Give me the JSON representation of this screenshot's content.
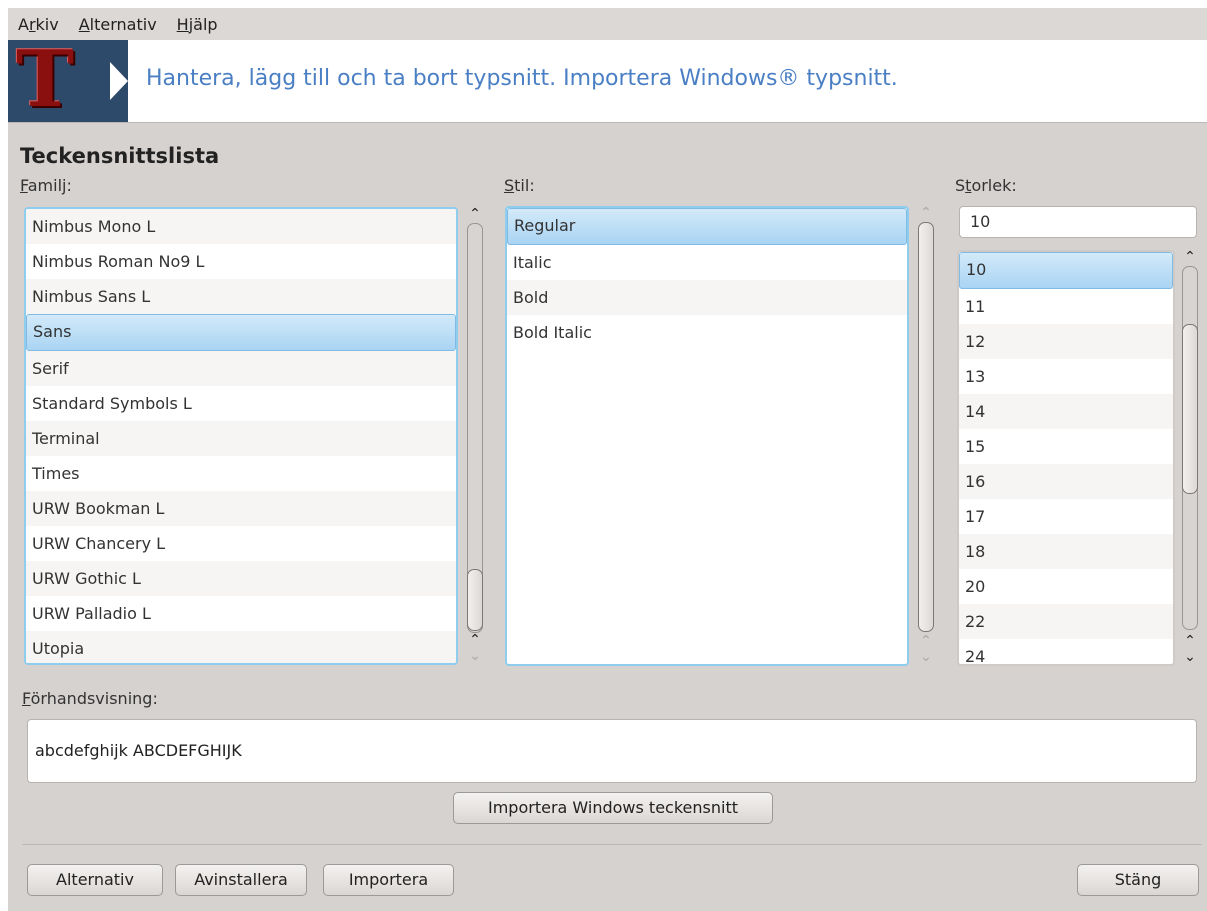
{
  "menubar": {
    "items": [
      {
        "label": "Arkiv",
        "mnemonic": "r"
      },
      {
        "label": "Alternativ",
        "mnemonic": "A"
      },
      {
        "label": "Hjälp",
        "mnemonic": "H"
      }
    ]
  },
  "banner": {
    "logo_letter": "T",
    "text": "Hantera, lägg till och ta bort typsnitt. Importera Windows® typsnitt."
  },
  "section_title": "Teckensnittslista",
  "family": {
    "label": "Familj:",
    "items": [
      "Nimbus Mono L",
      "Nimbus Roman No9 L",
      "Nimbus Sans L",
      "Sans",
      "Serif",
      "Standard Symbols L",
      "Terminal",
      "Times",
      "URW Bookman L",
      "URW Chancery L",
      "URW Gothic L",
      "URW Palladio L",
      "Utopia"
    ],
    "selected": "Sans"
  },
  "style": {
    "label": "Stil:",
    "items": [
      "Regular",
      "Italic",
      "Bold",
      "Bold Italic"
    ],
    "selected": "Regular"
  },
  "size": {
    "label": "Storlek:",
    "value": "10",
    "items": [
      "10",
      "11",
      "12",
      "13",
      "14",
      "15",
      "16",
      "17",
      "18",
      "20",
      "22",
      "24"
    ],
    "selected": "10"
  },
  "preview": {
    "label": "Förhandsvisning:",
    "text": "abcdefghijk ABCDEFGHIJK"
  },
  "buttons": {
    "import_windows": "Importera Windows teckensnitt",
    "options": "Alternativ",
    "uninstall": "Avinstallera",
    "import": "Importera",
    "close": "Stäng"
  },
  "colors": {
    "accent_text": "#4a7fc4",
    "selection": "#a9d4f3",
    "focus_border": "#8fcdee",
    "window_bg": "#d6d2d0"
  }
}
